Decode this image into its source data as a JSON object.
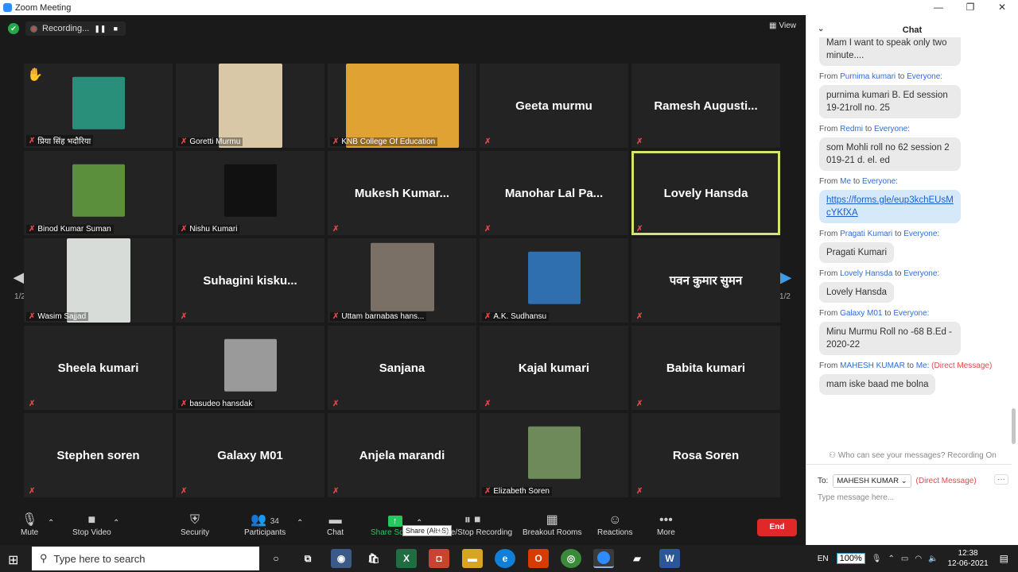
{
  "window": {
    "title": "Zoom Meeting",
    "minimize": "—",
    "maximize": "❐",
    "close": "✕"
  },
  "meeting": {
    "recording_label": "Recording...",
    "view_label": "View",
    "page_indicator": "1/2",
    "tiles": [
      {
        "name": "प्रिया सिंह भदौरिया",
        "video": true,
        "hand": true,
        "thumb_color": "#2a8f7a",
        "w": 66,
        "h": 66
      },
      {
        "name": "Goretti Murmu",
        "video": true,
        "thumb_color": "#d9c8a8",
        "w": 80,
        "h": 106
      },
      {
        "name": "KNB College Of Education",
        "video": true,
        "thumb_color": "#e0a232",
        "w": 142,
        "h": 106
      },
      {
        "name": "Geeta murmu",
        "video": false
      },
      {
        "name": "Ramesh  Augusti...",
        "video": false
      },
      {
        "name": "Binod Kumar Suman",
        "video": true,
        "thumb_color": "#5b8f3b",
        "w": 66,
        "h": 66
      },
      {
        "name": "Nishu Kumari",
        "video": true,
        "thumb_color": "#111111",
        "w": 66,
        "h": 66
      },
      {
        "name": "Mukesh  Kumar...",
        "video": false
      },
      {
        "name": "Manohar Lal Pa...",
        "video": false
      },
      {
        "name": "Lovely Hansda",
        "video": false,
        "active": true
      },
      {
        "name": "Wasim Sajjad",
        "video": true,
        "thumb_color": "#d8dcd8",
        "w": 80,
        "h": 106
      },
      {
        "name": "Suhagini  kisku...",
        "video": false
      },
      {
        "name": "Uttam barnabas hans...",
        "video": true,
        "thumb_color": "#7a7066",
        "w": 80,
        "h": 86
      },
      {
        "name": "A.K. Sudhansu",
        "video": true,
        "thumb_color": "#2f6fb0",
        "w": 66,
        "h": 66
      },
      {
        "name": "पवन कुमार सुमन",
        "video": false
      },
      {
        "name": "Sheela kumari",
        "video": false
      },
      {
        "name": "basudeo hansdak",
        "video": true,
        "thumb_color": "#9a9a9a",
        "w": 66,
        "h": 66
      },
      {
        "name": "Sanjana",
        "video": false
      },
      {
        "name": "Kajal kumari",
        "video": false
      },
      {
        "name": "Babita kumari",
        "video": false
      },
      {
        "name": "Stephen soren",
        "video": false
      },
      {
        "name": "Galaxy M01",
        "video": false
      },
      {
        "name": "Anjela marandi",
        "video": false
      },
      {
        "name": "Elizabeth Soren",
        "video": true,
        "thumb_color": "#6f8a5a",
        "w": 66,
        "h": 66
      },
      {
        "name": "Rosa Soren",
        "video": false
      }
    ]
  },
  "toolbar": {
    "mute": "Mute",
    "stop_video": "Stop Video",
    "security": "Security",
    "participants": "Participants",
    "participants_count": "34",
    "chat": "Chat",
    "share_screen": "Share Screen",
    "share_tooltip": "Share (Alt+S)",
    "pause_recording": "Pause/Stop Recording",
    "breakout": "Breakout Rooms",
    "reactions": "Reactions",
    "more": "More",
    "end": "End"
  },
  "chat": {
    "title": "Chat",
    "partial_top": "Mam   I want to speak only two minute....",
    "messages": [
      {
        "from": "Purnima kumari",
        "to": "Everyone:",
        "text": "purnima kumari B. Ed session 19-21roll no. 25"
      },
      {
        "from": "Redmi",
        "to": "Everyone:",
        "text": "som Mohli roll no 62 session 2019-21 d. el. ed"
      },
      {
        "from": "Me",
        "to": "Everyone:",
        "text": "https://forms.gle/eup3kchEUsMcYKfXA",
        "mine": true
      },
      {
        "from": "Pragati Kumari",
        "to": "Everyone:",
        "text": "Pragati Kumari"
      },
      {
        "from": "Lovely Hansda",
        "to": "Everyone:",
        "text": "Lovely Hansda"
      },
      {
        "from": "Galaxy M01",
        "to": "Everyone:",
        "text": "Minu Murmu Roll no -68 B.Ed  -2020-22"
      },
      {
        "from": "MAHESH KUMAR",
        "to": "Me:",
        "dm": "(Direct Message)",
        "text": "mam iske baad me bolna"
      }
    ],
    "from_word": "From",
    "to_word": "to",
    "privacy_note": "Who can see your messages? Recording On",
    "to_label": "To:",
    "recipient": "MAHESH KUMAR",
    "direct_message": "(Direct Message)",
    "input_placeholder": "Type message here..."
  },
  "taskbar": {
    "search_placeholder": "Type here to search",
    "lang": "EN",
    "battery": "100%",
    "time": "12:38",
    "date": "12-06-2021"
  }
}
